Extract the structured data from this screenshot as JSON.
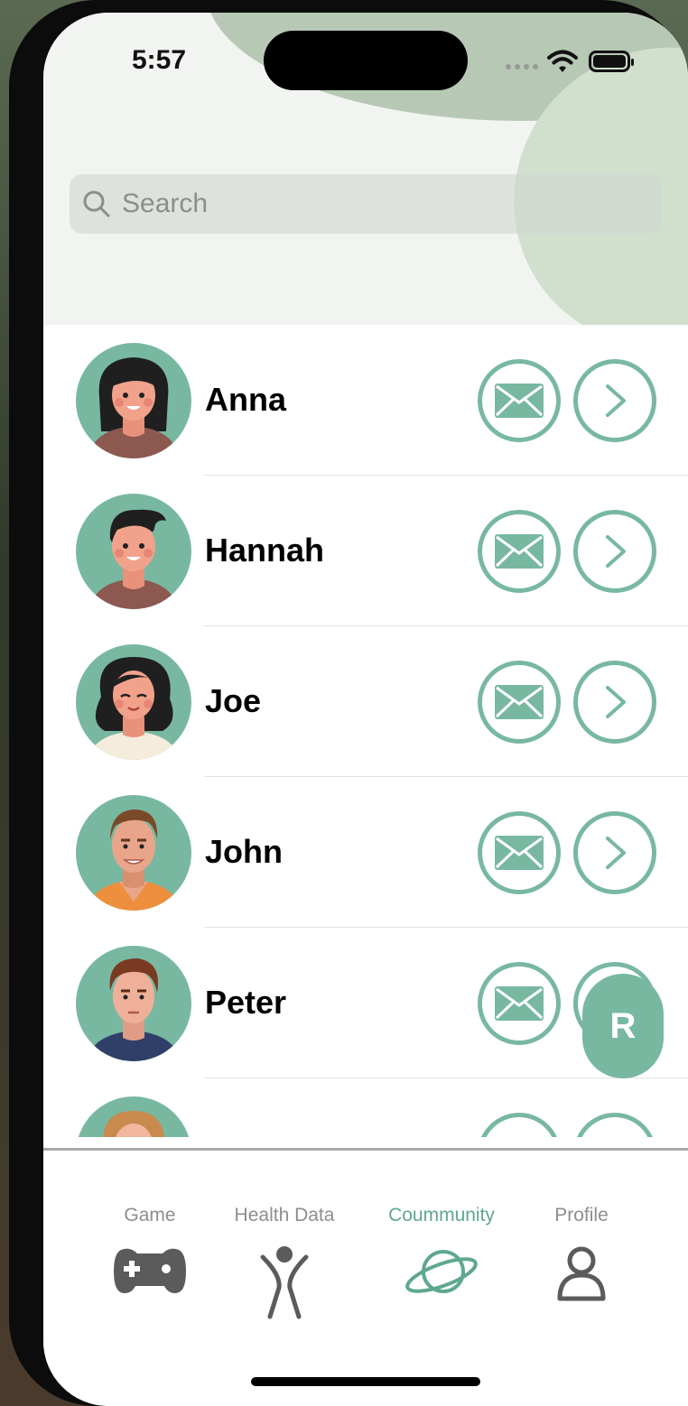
{
  "status": {
    "time": "5:57"
  },
  "search": {
    "placeholder": "Search",
    "icon": "magnifier"
  },
  "colors": {
    "accent": "#78b8a1",
    "active_tab": "#5fa88d",
    "inactive_tab": "#8e8e8e"
  },
  "contacts": [
    {
      "name": "Anna",
      "icons": [
        "mail-icon",
        "chevron-right-icon"
      ]
    },
    {
      "name": "Hannah",
      "icons": [
        "mail-icon",
        "chevron-right-icon"
      ]
    },
    {
      "name": "Joe",
      "icons": [
        "mail-icon",
        "chevron-right-icon"
      ]
    },
    {
      "name": "John",
      "icons": [
        "mail-icon",
        "chevron-right-icon"
      ]
    },
    {
      "name": "Peter",
      "icons": [
        "mail-icon",
        "chevron-right-icon"
      ]
    },
    {
      "name": "",
      "icons": [
        "mail-icon",
        "chevron-right-icon"
      ]
    }
  ],
  "fab": {
    "label": "R"
  },
  "tabbar": {
    "tabs": [
      {
        "label": "Game",
        "icon": "gamepad-icon",
        "active": false
      },
      {
        "label": "Health Data",
        "icon": "body-figure-icon",
        "active": false
      },
      {
        "label": "Coummunity",
        "icon": "planet-icon",
        "active": true
      },
      {
        "label": "Profile",
        "icon": "person-icon",
        "active": false
      }
    ]
  }
}
